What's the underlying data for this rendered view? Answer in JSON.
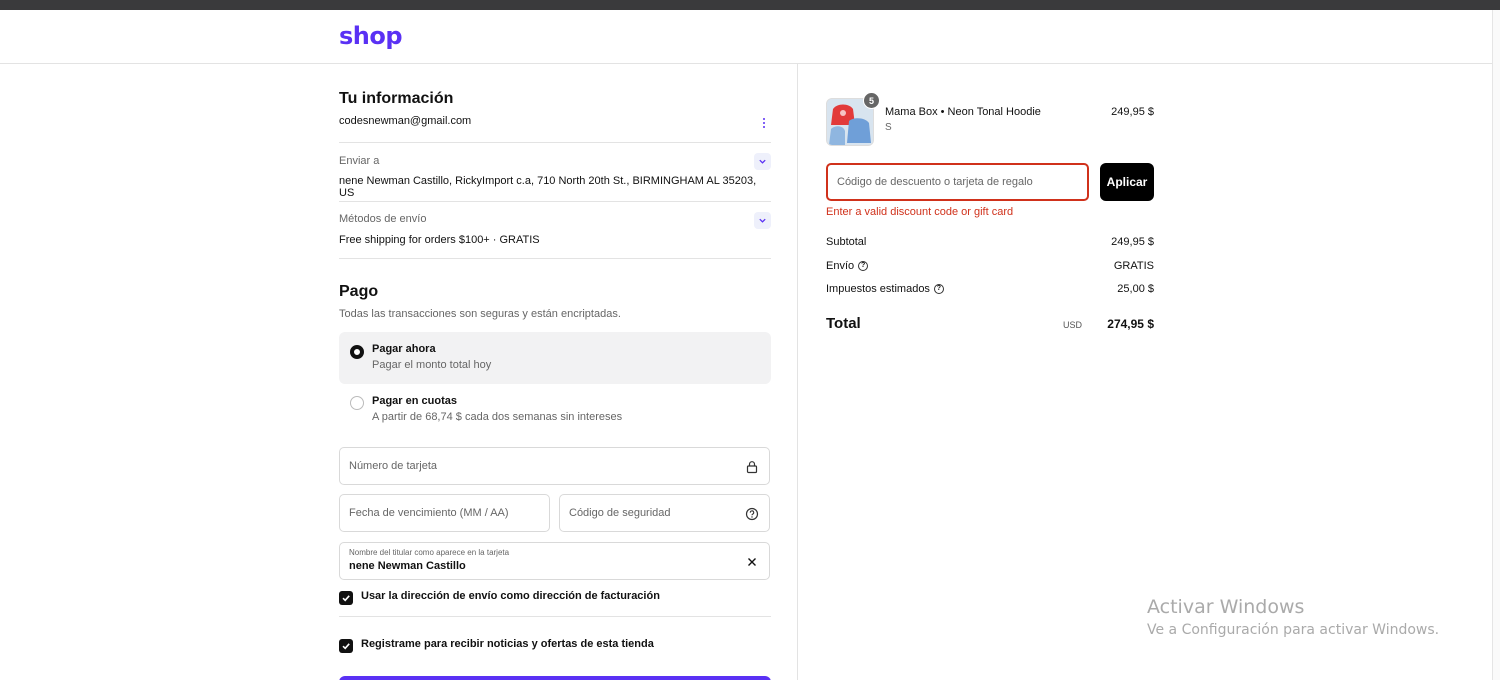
{
  "header": {
    "logo": "shop"
  },
  "info": {
    "title": "Tu información",
    "email": "codesnewman@gmail.com",
    "ship_to_label": "Enviar a",
    "ship_to_value": "nene Newman Castillo, RickyImport c.a, 710 North 20th St., BIRMINGHAM AL 35203, US",
    "shipping_method_label": "Métodos de envío",
    "shipping_method_value": "Free shipping for orders $100+ · GRATIS"
  },
  "payment": {
    "title": "Pago",
    "subtitle": "Todas las transacciones son seguras y están encriptadas.",
    "options": [
      {
        "title": "Pagar ahora",
        "subtitle": "Pagar el monto total hoy",
        "selected": true
      },
      {
        "title": "Pagar en cuotas",
        "subtitle": "A partir de 68,74 $ cada dos semanas sin intereses",
        "selected": false
      }
    ],
    "card_number_placeholder": "Número de tarjeta",
    "expiry_placeholder": "Fecha de vencimiento (MM / AA)",
    "security_code_placeholder": "Código de seguridad",
    "cardholder_label": "Nombre del titular como aparece en la tarjeta",
    "cardholder_value": "nene Newman Castillo",
    "use_shipping_as_billing": "Usar la dirección de envío como dirección de facturación",
    "subscribe": "Registrame para recibir noticias y ofertas de esta tienda"
  },
  "summary": {
    "product": {
      "name": "Mama Box • Neon Tonal Hoodie",
      "variant": "S",
      "price": "249,95 $",
      "quantity": "5"
    },
    "discount_placeholder": "Código de descuento o tarjeta de regalo",
    "apply_label": "Aplicar",
    "error": "Enter a valid discount code or gift card",
    "subtotal_label": "Subtotal",
    "subtotal_value": "249,95 $",
    "shipping_label": "Envío",
    "shipping_value": "GRATIS",
    "taxes_label": "Impuestos estimados",
    "taxes_value": "25,00 $",
    "total_label": "Total",
    "total_currency": "USD",
    "total_value": "274,95 $"
  },
  "watermark": {
    "title": "Activar Windows",
    "subtitle": "Ve a Configuración para activar Windows."
  },
  "colors": {
    "accent": "#5a31f4",
    "error": "#d0311b"
  }
}
